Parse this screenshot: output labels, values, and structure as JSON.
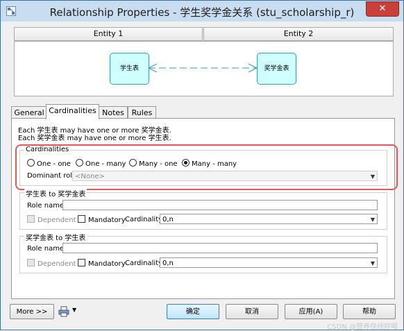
{
  "window": {
    "title": "Relationship Properties - 学生奖学金关系 (stu_scholarship_r)",
    "close_label": "✕"
  },
  "entities": {
    "entity1_header": "Entity 1",
    "entity2_header": "Entity 2",
    "entity1_name": "学生表",
    "entity2_name": "奖学金表"
  },
  "tabs": [
    {
      "label": "General"
    },
    {
      "label": "Cardinalities",
      "active": true
    },
    {
      "label": "Notes"
    },
    {
      "label": "Rules"
    }
  ],
  "description": {
    "line1": "Each 学生表 may have one or more 奖学金表.",
    "line2": "Each 奖学金表 may have one or more 学生表."
  },
  "cardinalities": {
    "group_title": "Cardinalities",
    "options": [
      {
        "label": "One - one",
        "selected": false
      },
      {
        "label": "One - many",
        "selected": false
      },
      {
        "label": "Many - one",
        "selected": false
      },
      {
        "label": "Many - many",
        "selected": true
      }
    ],
    "dominant_role_label": "Dominant role:",
    "dominant_role_value": "<None>"
  },
  "role1": {
    "group_title": "学生表 to 奖学金表",
    "role_name_label": "Role name:",
    "role_name_value": "",
    "dependent_label": "Dependent",
    "mandatory_label": "Mandatory",
    "cardinality_label": "Cardinality:",
    "cardinality_value": "0,n"
  },
  "role2": {
    "group_title": "奖学金表 to 学生表",
    "role_name_label": "Role name:",
    "role_name_value": "",
    "dependent_label": "Dependent",
    "mandatory_label": "Mandatory",
    "cardinality_label": "Cardinality:",
    "cardinality_value": "0,n"
  },
  "buttons": {
    "more": "More >>",
    "ok": "确定",
    "cancel": "取消",
    "apply": "应用(A)",
    "help": "帮助"
  },
  "watermark": "CSDN @营养快线好喝",
  "colors": {
    "titlebar": "#c9ddf1",
    "entity_fill": "#cfffff",
    "highlight": "#e05a5a",
    "close": "#c9403a"
  },
  "icons": [
    "app-icon",
    "close-icon",
    "printer-icon",
    "dropdown-arrow-icon"
  ]
}
